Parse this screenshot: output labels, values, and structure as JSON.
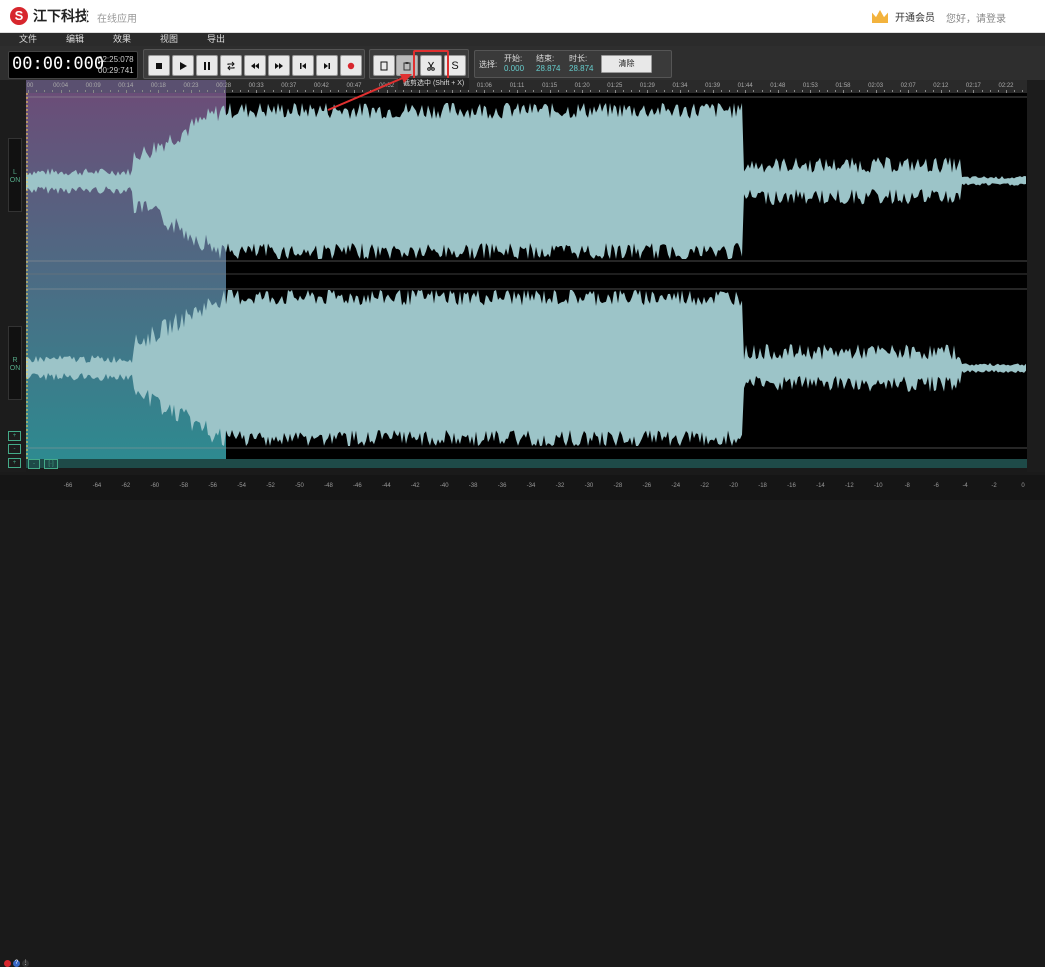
{
  "header": {
    "logo_char": "S",
    "logo_text": "江下科技",
    "online_app": "在线应用",
    "vip": "开通会员",
    "greeting": "您好，请登录"
  },
  "menu": [
    "文件",
    "编辑",
    "效果",
    "视图",
    "导出"
  ],
  "time": {
    "current": "00:00:000",
    "total": "02:25:078",
    "selection": "00:29:741"
  },
  "transport_buttons": [
    "stop-icon",
    "play-icon",
    "pause-icon",
    "loop-icon",
    "rewind-icon",
    "fast-forward-icon",
    "skip-start-icon",
    "skip-end-icon",
    "record-icon"
  ],
  "edit_buttons": [
    "copy-icon",
    "paste-icon",
    "scissors-icon",
    "silence-icon"
  ],
  "edit_silence_label": "S",
  "selection": {
    "label": "选择:",
    "start_label": "开始:",
    "start_value": "0.000",
    "end_label": "结束:",
    "end_value": "28.874",
    "duration_label": "时长:",
    "duration_value": "28.874",
    "clear_label": "清除"
  },
  "tooltip": "截剪选中 (Shift + X)",
  "ruler_ticks": [
    "00",
    "00:04",
    "00:09",
    "00:14",
    "00:18",
    "00:23",
    "00:28",
    "00:33",
    "00:37",
    "00:42",
    "00:47",
    "00:52",
    "00:56",
    "01:01",
    "01:06",
    "01:11",
    "01:15",
    "01:20",
    "01:25",
    "01:29",
    "01:34",
    "01:39",
    "01:44",
    "01:48",
    "01:53",
    "01:58",
    "02:03",
    "02:07",
    "02:12",
    "02:17",
    "02:22"
  ],
  "channels": {
    "left_name": "L",
    "left_state": "ON",
    "right_name": "R",
    "right_state": "ON"
  },
  "meter_ticks": [
    "-66",
    "-64",
    "-62",
    "-60",
    "-58",
    "-56",
    "-54",
    "-52",
    "-50",
    "-48",
    "-46",
    "-44",
    "-42",
    "-40",
    "-38",
    "-36",
    "-34",
    "-32",
    "-30",
    "-28",
    "-26",
    "-24",
    "-22",
    "-20",
    "-18",
    "-16",
    "-14",
    "-12",
    "-10",
    "-8",
    "-6",
    "-4",
    "-2",
    "0"
  ],
  "colors": {
    "waveform": "#9cc4c8",
    "selection_top": "#6b4d78",
    "selection_bottom": "#2e8a90",
    "brand_red": "#d7262d",
    "highlight": "#e03030"
  }
}
